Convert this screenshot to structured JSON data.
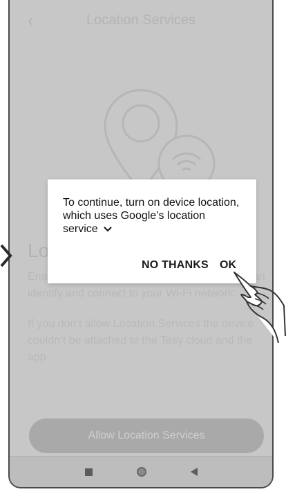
{
  "app": {
    "title": "Location Services",
    "back_icon": "chevron-left-icon"
  },
  "body": {
    "heading": "Lo",
    "enable_text_lines": [
      "Ena",
      "an",
      "identify and connect to your Wi-Fi network."
    ],
    "warning_text": "If you don’t allow Location Services the device couldn’t be attached to the Tesy cloud and the app",
    "allow_button": "Allow Location Services",
    "hero_icon": "location-wifi-icon"
  },
  "dialog": {
    "message": "To continue, turn on device location, which uses Google’s location service",
    "expand_icon": "chevron-down-icon",
    "no_thanks": "NO THANKS",
    "ok": "OK"
  },
  "navbar": {
    "icons": [
      "recent-apps-icon",
      "home-icon",
      "back-icon"
    ]
  },
  "colors": {
    "overlay": "#c7c7c7",
    "dialog_bg": "#ffffff",
    "dialog_text": "#111111"
  }
}
